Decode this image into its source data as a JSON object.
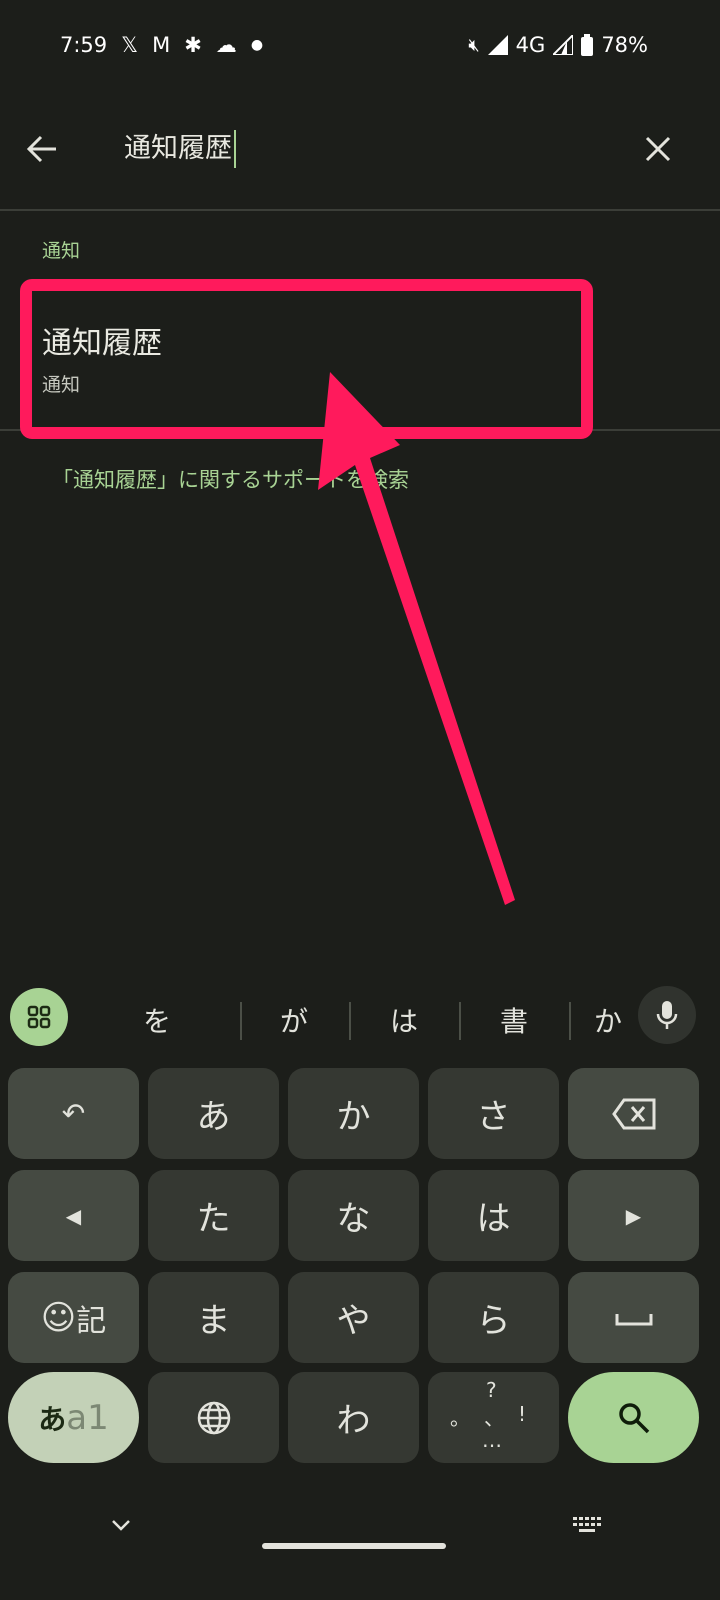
{
  "status_bar": {
    "time": "7:59",
    "network": "4G",
    "battery": "78%",
    "icons": [
      "x-icon",
      "gmail-icon",
      "pinwheel-icon",
      "cloud-icon",
      "dot-icon",
      "mute-icon",
      "signal-icon",
      "signal-icon-2",
      "battery-icon"
    ]
  },
  "search": {
    "query": "通知履歴"
  },
  "results": {
    "section": "通知",
    "item_title": "通知履歴",
    "item_subtitle": "通知",
    "support_link": "「通知履歴」に関するサポートを検索"
  },
  "annotation": {
    "color": "#ff1a5c"
  },
  "keyboard": {
    "suggestions": [
      "を",
      "が",
      "は",
      "書",
      "か"
    ],
    "keys": [
      "あ",
      "か",
      "さ",
      "た",
      "な",
      "は",
      "ま",
      "や",
      "ら",
      "わ"
    ],
    "emoji_label": "記",
    "mode_label_a": "あ",
    "mode_label_b": "a1",
    "punct": {
      "top": "?",
      "left": "。",
      "mid": "、",
      "right": "!",
      "bottom": "…"
    }
  },
  "colors": {
    "accent": "#a8d394",
    "background": "#1c1e1a"
  }
}
